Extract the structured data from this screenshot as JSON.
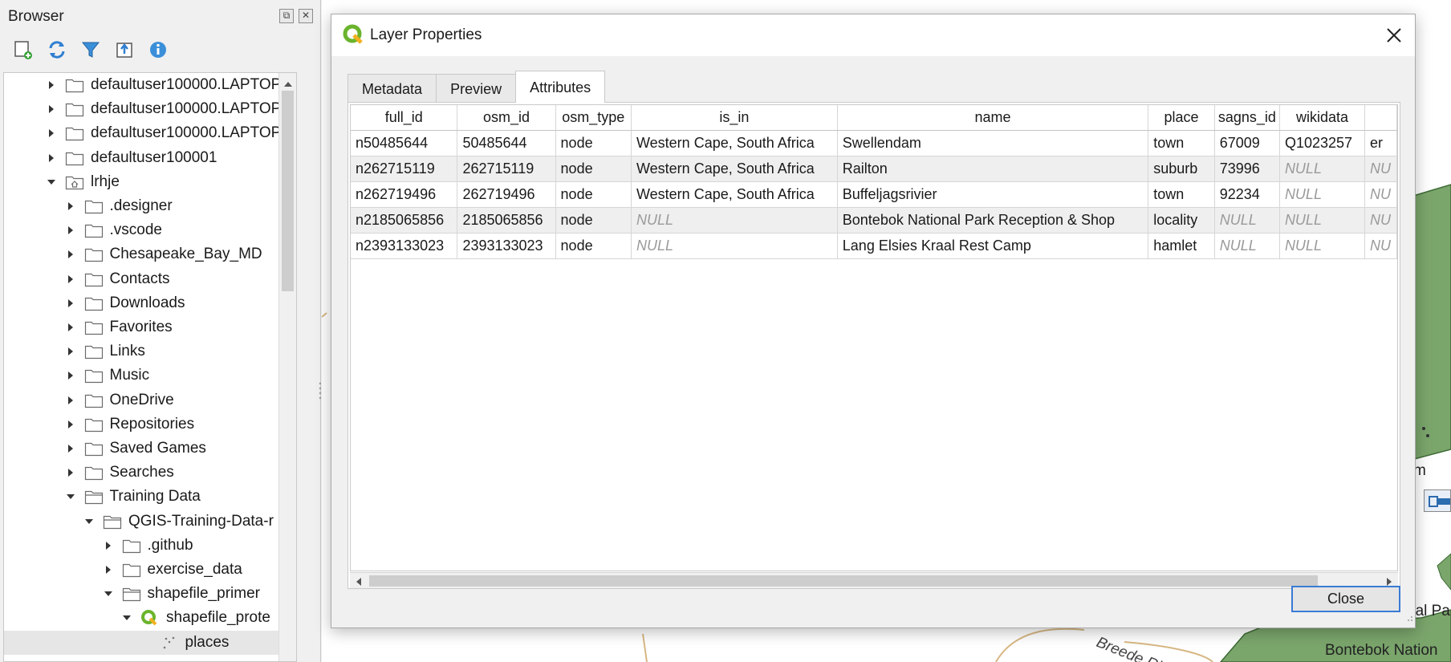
{
  "browser": {
    "title": "Browser",
    "header_buttons": [
      "float-icon",
      "close-icon"
    ],
    "toolbar": [
      "add-layer-icon",
      "refresh-icon",
      "filter-icon",
      "collapse-all-icon",
      "info-icon"
    ],
    "tree": [
      {
        "label": "defaultuser100000.LAPTOP-",
        "depth": 0,
        "expanded": false,
        "icon": "folder-icon"
      },
      {
        "label": "defaultuser100000.LAPTOP-",
        "depth": 0,
        "expanded": false,
        "icon": "folder-icon"
      },
      {
        "label": "defaultuser100000.LAPTOP-",
        "depth": 0,
        "expanded": false,
        "icon": "folder-icon"
      },
      {
        "label": "defaultuser100001",
        "depth": 0,
        "expanded": false,
        "icon": "folder-icon"
      },
      {
        "label": "lrhje",
        "depth": 0,
        "expanded": true,
        "icon": "home-folder-icon"
      },
      {
        "label": ".designer",
        "depth": 1,
        "expanded": false,
        "icon": "folder-icon"
      },
      {
        "label": ".vscode",
        "depth": 1,
        "expanded": false,
        "icon": "folder-icon"
      },
      {
        "label": "Chesapeake_Bay_MD",
        "depth": 1,
        "expanded": false,
        "icon": "folder-icon"
      },
      {
        "label": "Contacts",
        "depth": 1,
        "expanded": false,
        "icon": "folder-icon"
      },
      {
        "label": "Downloads",
        "depth": 1,
        "expanded": false,
        "icon": "folder-icon"
      },
      {
        "label": "Favorites",
        "depth": 1,
        "expanded": false,
        "icon": "folder-icon"
      },
      {
        "label": "Links",
        "depth": 1,
        "expanded": false,
        "icon": "folder-icon"
      },
      {
        "label": "Music",
        "depth": 1,
        "expanded": false,
        "icon": "folder-icon"
      },
      {
        "label": "OneDrive",
        "depth": 1,
        "expanded": false,
        "icon": "folder-icon"
      },
      {
        "label": "Repositories",
        "depth": 1,
        "expanded": false,
        "icon": "folder-icon"
      },
      {
        "label": "Saved Games",
        "depth": 1,
        "expanded": false,
        "icon": "folder-icon"
      },
      {
        "label": "Searches",
        "depth": 1,
        "expanded": false,
        "icon": "folder-icon"
      },
      {
        "label": "Training Data",
        "depth": 1,
        "expanded": true,
        "icon": "open-folder-icon"
      },
      {
        "label": "QGIS-Training-Data-r",
        "depth": 2,
        "expanded": true,
        "icon": "open-folder-icon"
      },
      {
        "label": ".github",
        "depth": 3,
        "expanded": false,
        "icon": "folder-icon"
      },
      {
        "label": "exercise_data",
        "depth": 3,
        "expanded": false,
        "icon": "folder-icon"
      },
      {
        "label": "shapefile_primer",
        "depth": 3,
        "expanded": true,
        "icon": "open-folder-icon"
      },
      {
        "label": "shapefile_prote",
        "depth": 4,
        "expanded": true,
        "icon": "qgis-project-icon"
      },
      {
        "label": "places",
        "depth": 5,
        "leaf": true,
        "selected": true,
        "icon": "point-layer-icon"
      }
    ]
  },
  "map": {
    "labels": [
      "m",
      "Breede Ri",
      "nal Pa",
      "Bontebok Nation"
    ],
    "fill_color": "#7aa56b",
    "stroke_color": "#3d6a35",
    "line_color": "#d7b783"
  },
  "dialog": {
    "title": "Layer Properties",
    "tabs": [
      {
        "label": "Metadata",
        "active": false
      },
      {
        "label": "Preview",
        "active": false
      },
      {
        "label": "Attributes",
        "active": true
      }
    ],
    "table": {
      "columns": [
        "full_id",
        "osm_id",
        "osm_type",
        "is_in",
        "name",
        "place",
        "sagns_id",
        "wikidata",
        ""
      ],
      "rows": [
        [
          "n50485644",
          "50485644",
          "node",
          "Western Cape, South Africa",
          "Swellendam",
          "town",
          "67009",
          "Q1023257",
          "er"
        ],
        [
          "n262715119",
          "262715119",
          "node",
          "Western Cape, South Africa",
          "Railton",
          "suburb",
          "73996",
          "NULL",
          "NU"
        ],
        [
          "n262719496",
          "262719496",
          "node",
          "Western Cape, South Africa",
          "Buffeljagsrivier",
          "town",
          "92234",
          "NULL",
          "NU"
        ],
        [
          "n2185065856",
          "2185065856",
          "node",
          "NULL",
          "Bontebok National Park Reception & Shop",
          "locality",
          "NULL",
          "NULL",
          "NU"
        ],
        [
          "n2393133023",
          "2393133023",
          "node",
          "NULL",
          "Lang Elsies Kraal Rest Camp",
          "hamlet",
          "NULL",
          "NULL",
          "NU"
        ]
      ]
    },
    "close_button": "Close"
  }
}
